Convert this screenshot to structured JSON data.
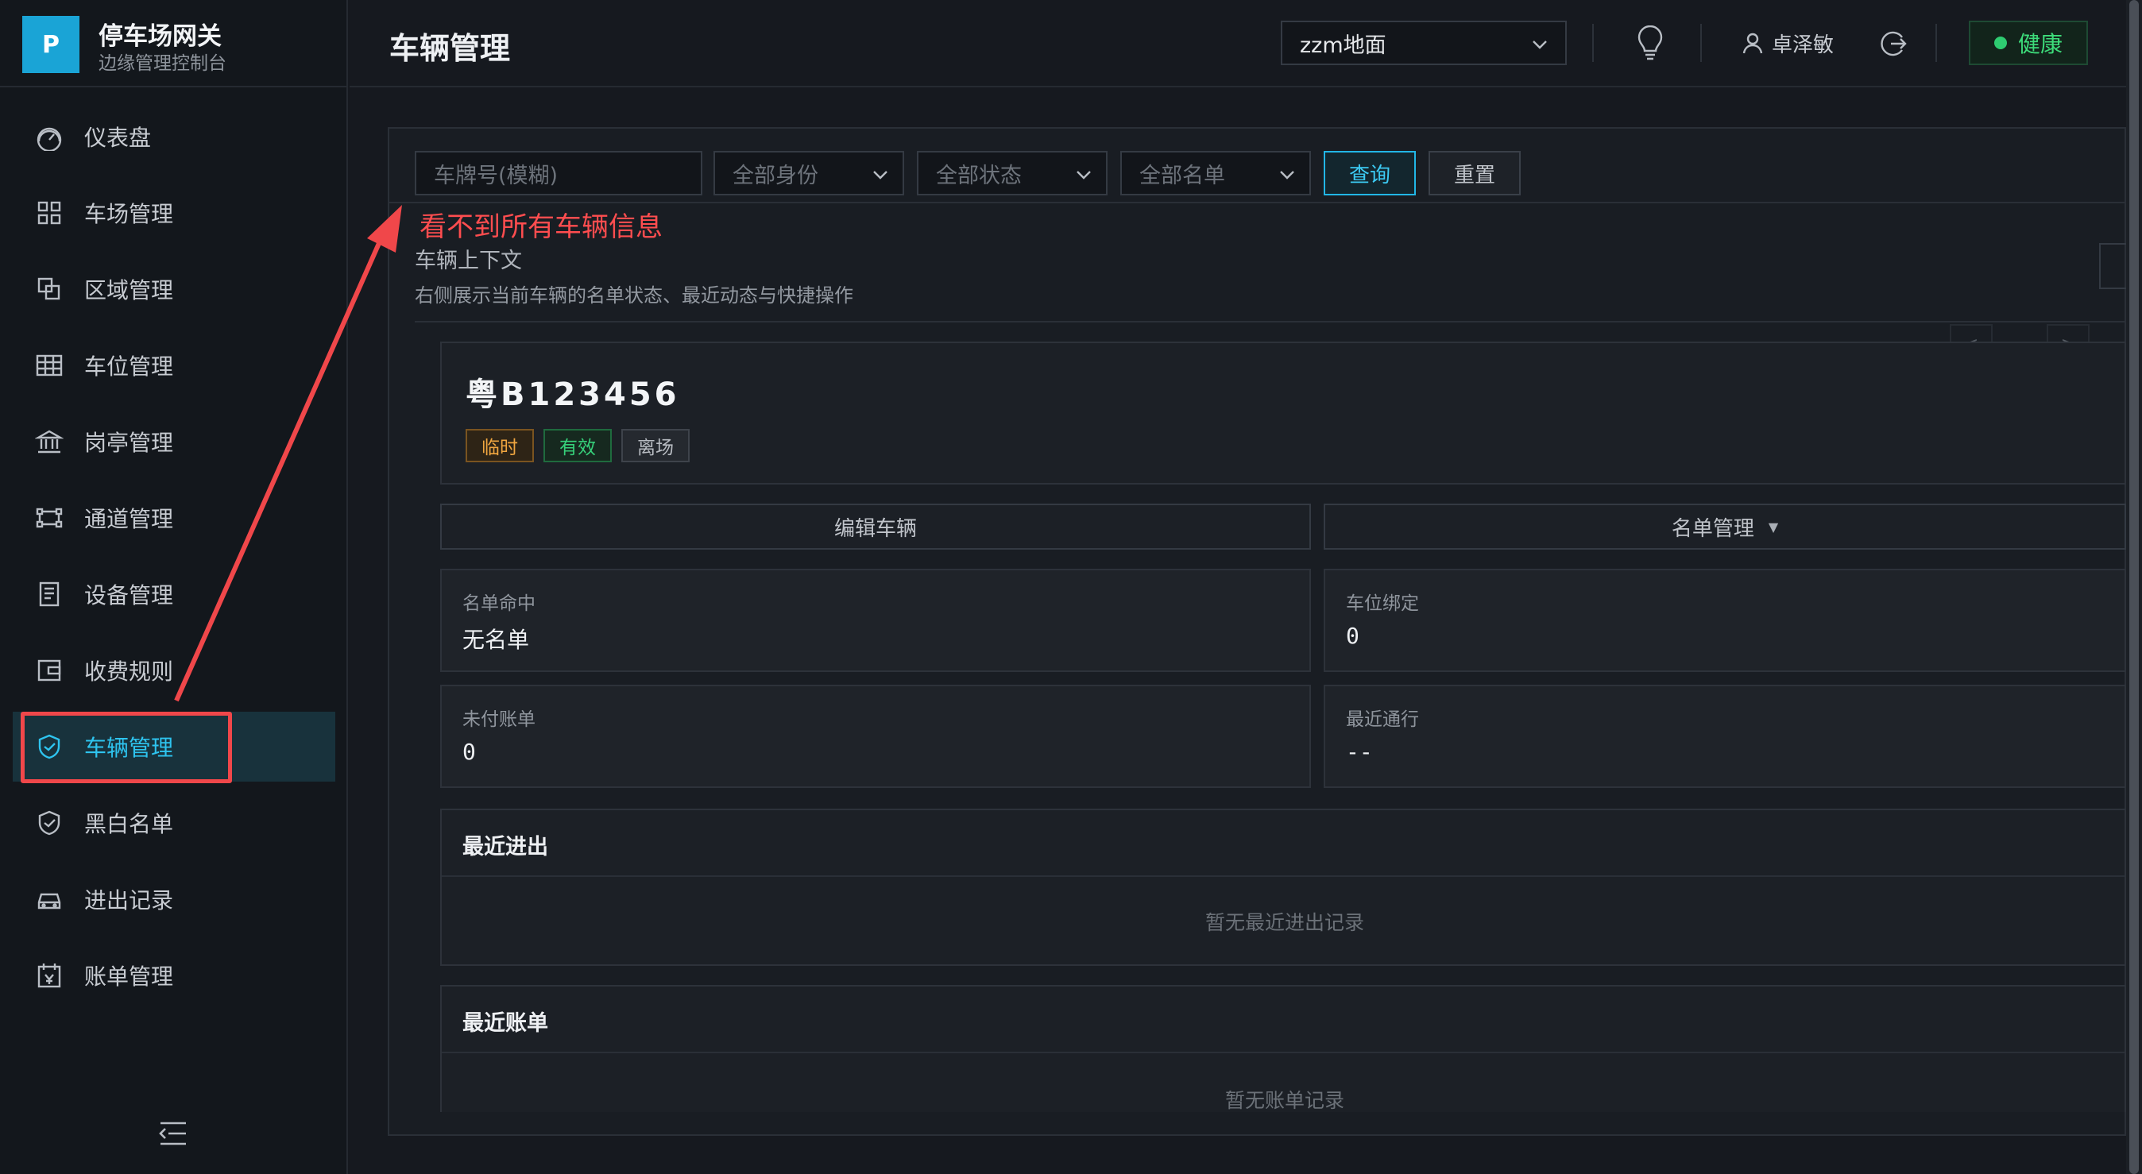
{
  "brand": {
    "logo_letter": "P",
    "title": "停车场网关",
    "subtitle": "边缘管理控制台"
  },
  "sidebar": {
    "items": [
      {
        "label": "仪表盘",
        "icon": "dashboard-icon"
      },
      {
        "label": "车场管理",
        "icon": "grid-icon"
      },
      {
        "label": "区域管理",
        "icon": "layers-icon"
      },
      {
        "label": "车位管理",
        "icon": "table-icon"
      },
      {
        "label": "岗亭管理",
        "icon": "bank-icon"
      },
      {
        "label": "通道管理",
        "icon": "channel-icon"
      },
      {
        "label": "设备管理",
        "icon": "device-icon"
      },
      {
        "label": "收费规则",
        "icon": "wallet-icon"
      },
      {
        "label": "车辆管理",
        "icon": "shield-check-icon",
        "active": true
      },
      {
        "label": "黑白名单",
        "icon": "shield-icon"
      },
      {
        "label": "进出记录",
        "icon": "car-icon"
      },
      {
        "label": "账单管理",
        "icon": "bill-icon"
      }
    ],
    "collapse_icon": "menu-fold-icon"
  },
  "header": {
    "page_title": "车辆管理",
    "lot_select": "zzm地面",
    "user_name": "卓泽敏",
    "health_label": "健康",
    "health_color": "#2ecc71"
  },
  "filters": {
    "plate_placeholder": "车牌号(模糊)",
    "identity_select": "全部身份",
    "status_select": "全部状态",
    "list_select": "全部名单",
    "query_label": "查询",
    "reset_label": "重置"
  },
  "annotation": {
    "text": "看不到所有车辆信息",
    "color": "#ff4d4f"
  },
  "context": {
    "title": "车辆上下文",
    "subtitle": "右侧展示当前车辆的名单状态、最近动态与快捷操作",
    "prev": "<",
    "next": ">"
  },
  "vehicle": {
    "plate": "粤B123456",
    "tags": [
      "临时",
      "有效",
      "离场"
    ]
  },
  "actions": {
    "edit_label": "编辑车辆",
    "list_label": "名单管理",
    "list_caret": "▼"
  },
  "stats": {
    "list_hit_label": "名单命中",
    "list_hit_value": "无名单",
    "space_bind_label": "车位绑定",
    "space_bind_value": "0",
    "unpaid_label": "未付账单",
    "unpaid_value": "0",
    "last_pass_label": "最近通行",
    "last_pass_value": "--"
  },
  "recent_io": {
    "title": "最近进出",
    "empty": "暂无最近进出记录"
  },
  "recent_bills": {
    "title": "最近账单",
    "empty": "暂无账单记录"
  },
  "colors": {
    "accent": "#2ec4ef",
    "background": "#16191f",
    "sidebar": "#13171c",
    "warning": "#f0a640",
    "success": "#36d07a"
  }
}
